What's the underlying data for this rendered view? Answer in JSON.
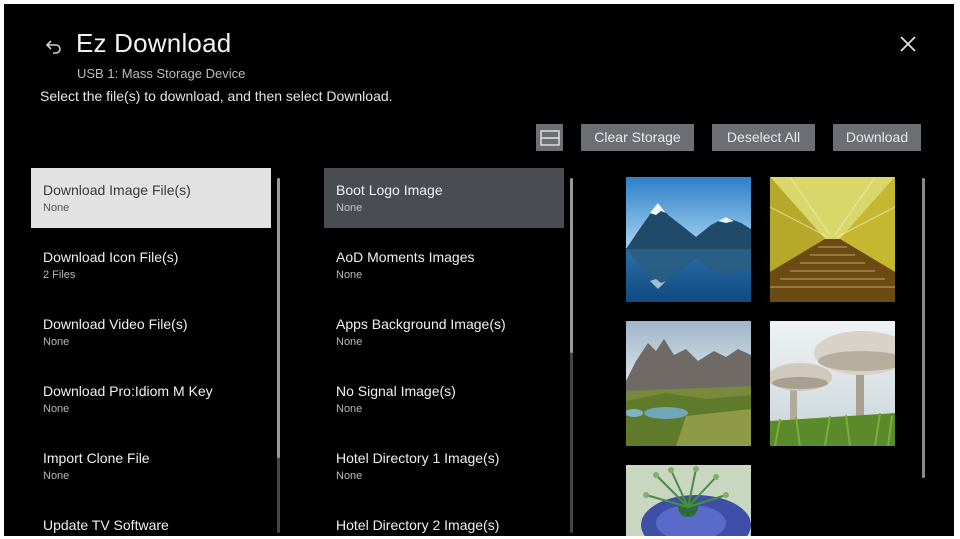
{
  "header": {
    "title": "Ez Download",
    "subtitle": "USB 1: Mass Storage Device",
    "instruction": "Select the file(s) to download, and then select Download."
  },
  "toolbar": {
    "clear_storage": "Clear Storage",
    "deselect_all": "Deselect All",
    "download": "Download"
  },
  "categories": [
    {
      "name": "Download Image File(s)",
      "status": "None"
    },
    {
      "name": "Download Icon File(s)",
      "status": "2 Files"
    },
    {
      "name": "Download Video File(s)",
      "status": "None"
    },
    {
      "name": "Download Pro:Idiom M Key",
      "status": "None"
    },
    {
      "name": "Import Clone File",
      "status": "None"
    },
    {
      "name": "Update TV Software",
      "status": ""
    }
  ],
  "image_types": [
    {
      "name": "Boot Logo Image",
      "status": "None"
    },
    {
      "name": "AoD Moments Images",
      "status": "None"
    },
    {
      "name": "Apps Background Image(s)",
      "status": "None"
    },
    {
      "name": "No Signal Image(s)",
      "status": "None"
    },
    {
      "name": "Hotel Directory 1 Image(s)",
      "status": "None"
    },
    {
      "name": "Hotel Directory 2 Image(s)",
      "status": ""
    }
  ],
  "colors": {
    "background": "#000000",
    "button": "#6b6f73",
    "selected_left": "#e2e2e2",
    "selected_mid": "#494d52"
  },
  "icons": {
    "back": "back-arrow-icon",
    "close": "close-icon",
    "view_toggle": "list-view-icon"
  }
}
